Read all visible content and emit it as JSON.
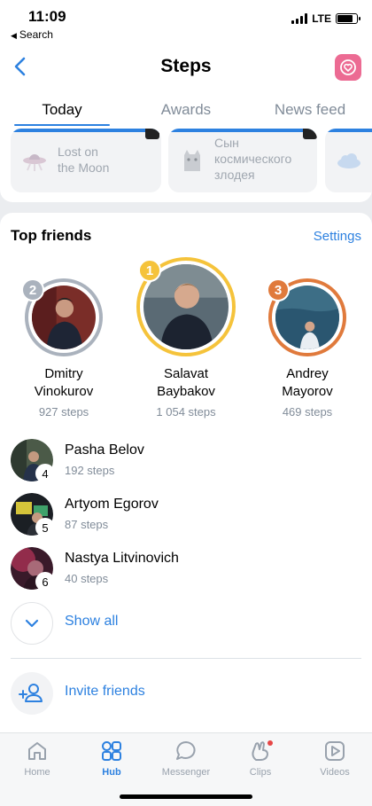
{
  "status_bar": {
    "time": "11:09",
    "back_label": "Search",
    "network": "LTE"
  },
  "nav": {
    "title": "Steps"
  },
  "tabs": [
    {
      "label": "Today",
      "active": true
    },
    {
      "label": "Awards",
      "active": false
    },
    {
      "label": "News feed",
      "active": false
    }
  ],
  "awards": [
    {
      "text": "Lost on the Moon",
      "line1": "Lost on",
      "line2": "the Moon"
    },
    {
      "text": "Сын космического злодея",
      "line1": "Сын",
      "line2": "космического",
      "line3": "злодея"
    }
  ],
  "top_friends": {
    "title": "Top friends",
    "settings_label": "Settings",
    "podium": [
      {
        "rank": "2",
        "first": "Dmitry",
        "last": "Vinokurov",
        "steps": "927 steps",
        "ring_color": "#aab2bd"
      },
      {
        "rank": "1",
        "first": "Salavat",
        "last": "Baybakov",
        "steps": "1 054 steps",
        "ring_color": "#f5c33b"
      },
      {
        "rank": "3",
        "first": "Andrey",
        "last": "Mayorov",
        "steps": "469 steps",
        "ring_color": "#e07a3c"
      }
    ],
    "list": [
      {
        "rank": "4",
        "name": "Pasha Belov",
        "steps": "192 steps"
      },
      {
        "rank": "5",
        "name": "Artyom Egorov",
        "steps": "87 steps"
      },
      {
        "rank": "6",
        "name": "Nastya Litvinovich",
        "steps": "40 steps"
      }
    ],
    "show_all_label": "Show all",
    "invite_label": "Invite friends"
  },
  "tabbar": [
    {
      "label": "Home",
      "icon": "home-icon"
    },
    {
      "label": "Hub",
      "icon": "hub-icon",
      "active": true
    },
    {
      "label": "Messenger",
      "icon": "messenger-icon"
    },
    {
      "label": "Clips",
      "icon": "clips-icon",
      "notification": true
    },
    {
      "label": "Videos",
      "icon": "videos-icon"
    }
  ],
  "colors": {
    "accent": "#2d81e0",
    "heart_button": "#ec6b93",
    "notification_dot": "#e64646"
  }
}
